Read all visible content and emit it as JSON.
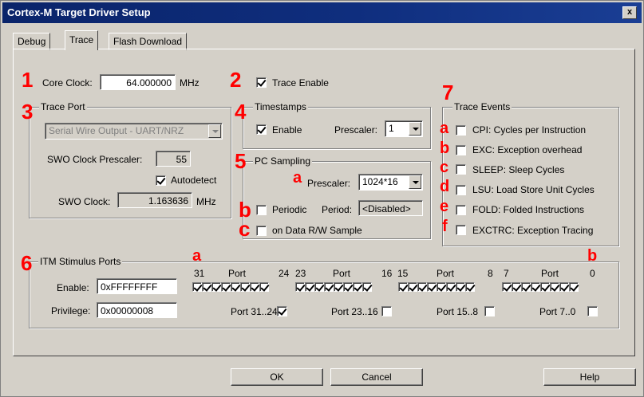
{
  "window": {
    "title": "Cortex-M Target Driver Setup",
    "close_label": "x"
  },
  "tabs": [
    {
      "label": "Debug"
    },
    {
      "label": "Trace"
    },
    {
      "label": "Flash Download"
    }
  ],
  "markers": {
    "n1": "1",
    "n2": "2",
    "n3": "3",
    "n4": "4",
    "n5": "5",
    "n6": "6",
    "n7": "7",
    "a": "a",
    "b": "b",
    "c": "c",
    "d": "d",
    "e": "e",
    "f": "f"
  },
  "core_clock": {
    "label": "Core Clock:",
    "value": "64.000000",
    "unit": "MHz"
  },
  "trace_enable": {
    "label": "Trace Enable",
    "checked": true
  },
  "trace_port": {
    "title": "Trace Port",
    "mode_value": "Serial Wire Output - UART/NRZ",
    "swo_prescaler_label": "SWO Clock Prescaler:",
    "swo_prescaler_value": "55",
    "autodetect_label": "Autodetect",
    "autodetect_checked": true,
    "swo_clock_label": "SWO Clock:",
    "swo_clock_value": "1.163636",
    "swo_clock_unit": "MHz"
  },
  "timestamps": {
    "title": "Timestamps",
    "enable_label": "Enable",
    "enable_checked": true,
    "prescaler_label": "Prescaler:",
    "prescaler_value": "1"
  },
  "pc_sampling": {
    "title": "PC Sampling",
    "prescaler_label": "Prescaler:",
    "prescaler_value": "1024*16",
    "periodic_label": "Periodic",
    "period_label": "Period:",
    "period_value": "<Disabled>",
    "data_rw_label": "on Data R/W Sample"
  },
  "trace_events": {
    "title": "Trace Events",
    "items": [
      {
        "label": "CPI: Cycles per Instruction"
      },
      {
        "label": "EXC: Exception overhead"
      },
      {
        "label": "SLEEP: Sleep Cycles"
      },
      {
        "label": "LSU: Load Store Unit Cycles"
      },
      {
        "label": "FOLD: Folded Instructions"
      },
      {
        "label": "EXCTRC: Exception Tracing"
      }
    ]
  },
  "itm": {
    "title": "ITM Stimulus Ports",
    "enable_label": "Enable:",
    "enable_value": "0xFFFFFFFF",
    "privilege_label": "Privilege:",
    "privilege_value": "0x00000008",
    "header": {
      "n31": "31",
      "port1": "Port",
      "n24": "24",
      "n23": "23",
      "port2": "Port",
      "n16": "16",
      "n15": "15",
      "port3": "Port",
      "n8": "8",
      "n7": "7",
      "port4": "Port",
      "n0": "0"
    },
    "port_groups": [
      {
        "label": "Port 31..24",
        "checked": true
      },
      {
        "label": "Port 23..16",
        "checked": false
      },
      {
        "label": "Port 15..8",
        "checked": false
      },
      {
        "label": "Port 7..0",
        "checked": false
      }
    ]
  },
  "buttons": {
    "ok": "OK",
    "cancel": "Cancel",
    "help": "Help"
  }
}
